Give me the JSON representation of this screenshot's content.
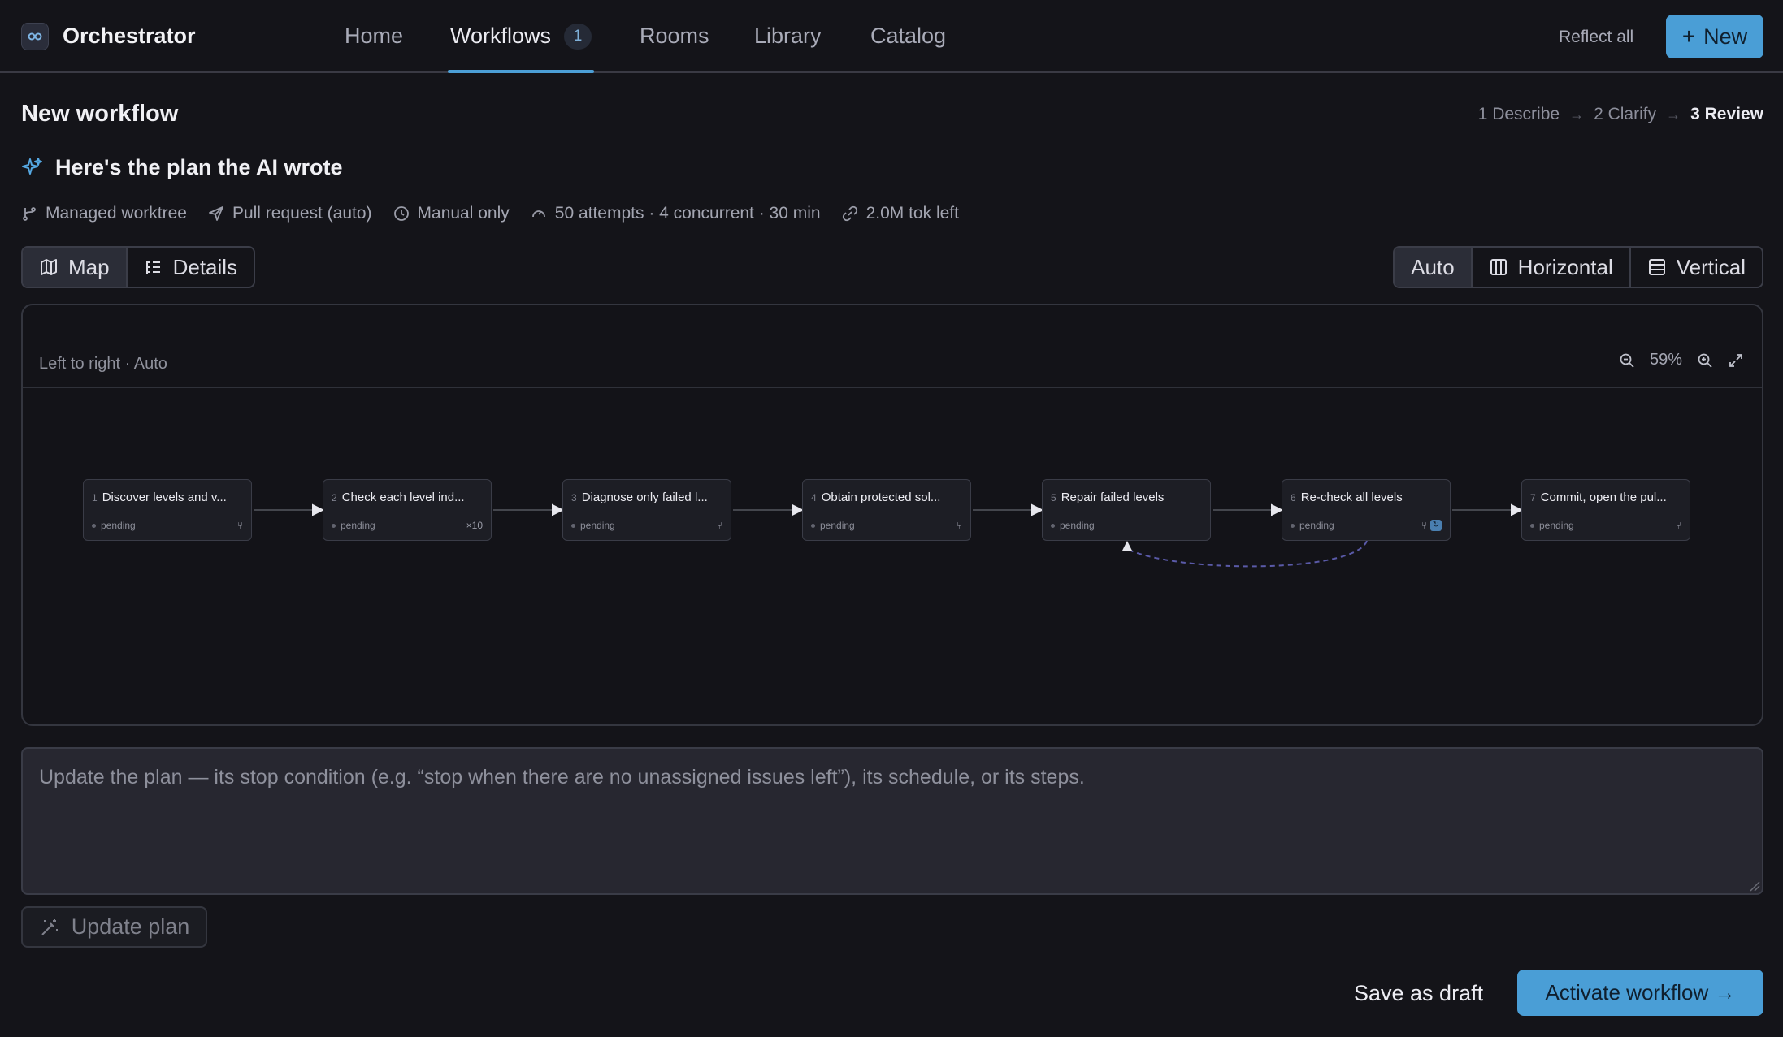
{
  "app": {
    "title": "Orchestrator"
  },
  "nav": {
    "items": [
      {
        "label": "Home"
      },
      {
        "label": "Workflows",
        "badge": "1"
      },
      {
        "label": "Rooms"
      },
      {
        "label": "Library"
      },
      {
        "label": "Catalog"
      }
    ],
    "active": "Workflows"
  },
  "header": {
    "reflect_label": "Reflect all",
    "new_label": "New"
  },
  "page": {
    "title": "New workflow",
    "steps": [
      {
        "label": "1 Describe"
      },
      {
        "label": "2 Clarify"
      },
      {
        "label": "3 Review",
        "current": true
      }
    ]
  },
  "plan": {
    "heading": "Here's the plan the AI wrote",
    "meta": [
      {
        "icon": "branch-icon",
        "label": "Managed worktree"
      },
      {
        "icon": "send-icon",
        "label": "Pull request (auto)"
      },
      {
        "icon": "clock-icon",
        "label": "Manual only"
      },
      {
        "icon": "gauge-icon",
        "label": "50 attempts · 4 concurrent · 30 min"
      },
      {
        "icon": "link-icon",
        "label": "2.0M tok left"
      }
    ]
  },
  "view_toggle": {
    "map": "Map",
    "details": "Details",
    "selected": "Map"
  },
  "layout_toggle": {
    "auto": "Auto",
    "horizontal": "Horizontal",
    "vertical": "Vertical",
    "selected": "Auto"
  },
  "canvas": {
    "direction_label": "Left to right · Auto",
    "zoom": "59%",
    "nodes": [
      {
        "num": "1",
        "title": "Discover levels and v...",
        "status": "pending",
        "icon": "branch"
      },
      {
        "num": "2",
        "title": "Check each level ind...",
        "status": "pending",
        "icon": "×10"
      },
      {
        "num": "3",
        "title": "Diagnose only failed l...",
        "status": "pending",
        "icon": "branch"
      },
      {
        "num": "4",
        "title": "Obtain protected sol...",
        "status": "pending",
        "icon": "branch"
      },
      {
        "num": "5",
        "title": "Repair failed levels",
        "status": "pending",
        "icon": ""
      },
      {
        "num": "6",
        "title": "Re-check all levels",
        "status": "pending",
        "icon": "branch+loop"
      },
      {
        "num": "7",
        "title": "Commit, open the pul...",
        "status": "pending",
        "icon": "branch"
      }
    ]
  },
  "update": {
    "placeholder": "Update the plan — its stop condition (e.g. “stop when there are no unassigned issues left”), its schedule, or its steps.",
    "button_label": "Update plan"
  },
  "footer": {
    "draft_label": "Save as draft",
    "activate_label": "Activate workflow →"
  },
  "colors": {
    "accent": "#4a9ed6",
    "background": "#141419",
    "loop_edge": "#5a5aa8"
  }
}
